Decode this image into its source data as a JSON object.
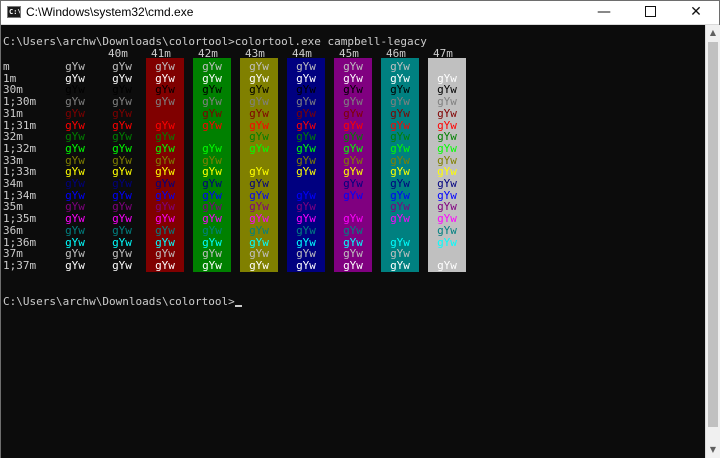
{
  "window": {
    "title": "C:\\Windows\\system32\\cmd.exe",
    "icon_label": "C:\\",
    "minimize": "—",
    "maximize": "□",
    "close": "✕"
  },
  "console": {
    "command_line": "C:\\Users\\archw\\Downloads\\colortool>colortool.exe campbell-legacy",
    "prompt_line": "C:\\Users\\archw\\Downloads\\colortool>",
    "sample_text": "gYw",
    "column_headers": [
      "40m",
      "41m",
      "42m",
      "43m",
      "44m",
      "45m",
      "46m",
      "47m"
    ],
    "row_labels": [
      "m",
      "1m",
      "30m",
      "1;30m",
      "31m",
      "1;31m",
      "32m",
      "1;32m",
      "33m",
      "1;33m",
      "34m",
      "1;34m",
      "35m",
      "1;35m",
      "36m",
      "1;36m",
      "37m",
      "1;37m"
    ],
    "row_fg_colors": [
      "#c0c0c0",
      "#ffffff",
      "#000000",
      "#808080",
      "#800000",
      "#ff0000",
      "#008000",
      "#00ff00",
      "#808000",
      "#ffff00",
      "#000080",
      "#0000ff",
      "#800080",
      "#ff00ff",
      "#008080",
      "#00ffff",
      "#c0c0c0",
      "#ffffff"
    ],
    "column_bg_colors": [
      "#800000",
      "#008000",
      "#808000",
      "#000080",
      "#800080",
      "#008080",
      "#c0c0c0"
    ],
    "background": "#000000",
    "default_text_color": "#c0c0c0"
  }
}
